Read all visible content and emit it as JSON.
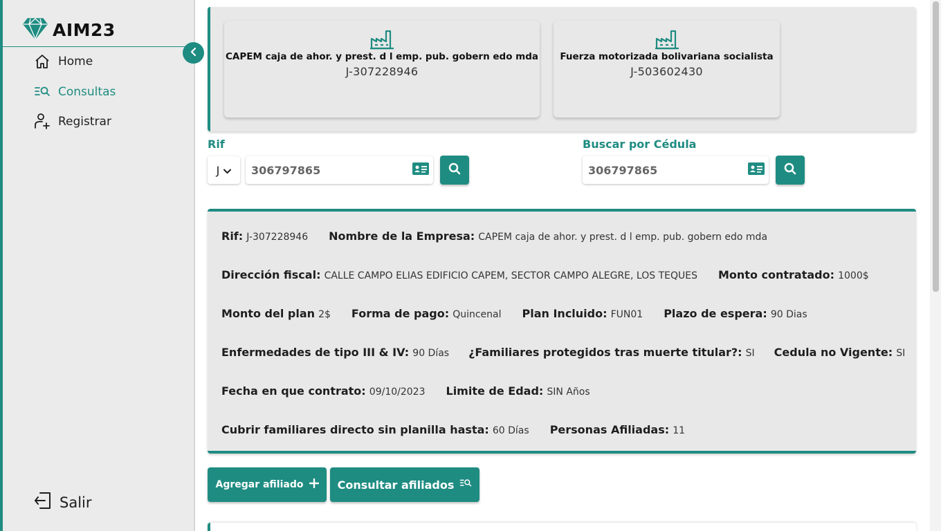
{
  "brand": {
    "title": "AIM23",
    "icon": "diamond-icon"
  },
  "sidebar": {
    "items": [
      {
        "label": "Home",
        "icon": "home-icon"
      },
      {
        "label": "Consultas",
        "icon": "search-list-icon",
        "active": true
      },
      {
        "label": "Registrar",
        "icon": "add-user-icon"
      }
    ],
    "logout_label": "Salir"
  },
  "companies": [
    {
      "name": "CAPEM caja de ahor. y prest. d l emp. pub. gobern edo mda",
      "rif": "J-307228946",
      "icon": "factory-icon"
    },
    {
      "name": "Fuerza motorizada bolivariana socialista",
      "rif": "J-503602430",
      "icon": "factory-icon"
    }
  ],
  "search": {
    "rif_label": "Rif",
    "rif_type": "J",
    "rif_value": "306797865",
    "cedula_label": "Buscar por Cédula",
    "cedula_value": "306797865"
  },
  "details": {
    "rif_k": "Rif:",
    "rif_v": "J-307228946",
    "nombre_k": "Nombre de la Empresa:",
    "nombre_v": "CAPEM caja de ahor. y prest. d l emp. pub. gobern edo mda",
    "direccion_k": "Dirección fiscal:",
    "direccion_v": "CALLE CAMPO ELIAS EDIFICIO CAPEM, SECTOR CAMPO ALEGRE, LOS TEQUES",
    "monto_contratado_k": "Monto contratado:",
    "monto_contratado_v": "1000$",
    "monto_plan_k": "Monto del plan",
    "monto_plan_v": "2$",
    "forma_pago_k": "Forma de pago:",
    "forma_pago_v": "Quincenal",
    "plan_incluido_k": "Plan Incluido:",
    "plan_incluido_v": "FUN01",
    "plazo_k": "Plazo de espera:",
    "plazo_v": "90 Dias",
    "enfermedades_k": "Enfermedades de tipo III & IV:",
    "enfermedades_v": "90 Días",
    "familiares_k": "¿Familiares protegidos tras muerte titular?:",
    "familiares_v": "SI",
    "cedula_nv_k": "Cedula no Vigente:",
    "cedula_nv_v": "SI",
    "fecha_k": "Fecha en que contrato:",
    "fecha_v": "09/10/2023",
    "limite_k": "Limite de Edad:",
    "limite_v": "SIN Años",
    "cubrir_k": "Cubrir familiares directo sin planilla hasta:",
    "cubrir_v": "60 Días",
    "personas_k": "Personas Afiliadas:",
    "personas_v": "11"
  },
  "actions": {
    "add_label": "Agregar afiliado",
    "consult_label": "Consultar afiliados"
  },
  "colors": {
    "accent": "#1f8c82",
    "panel": "#e8e8e8",
    "sidebar": "#ebebeb"
  }
}
